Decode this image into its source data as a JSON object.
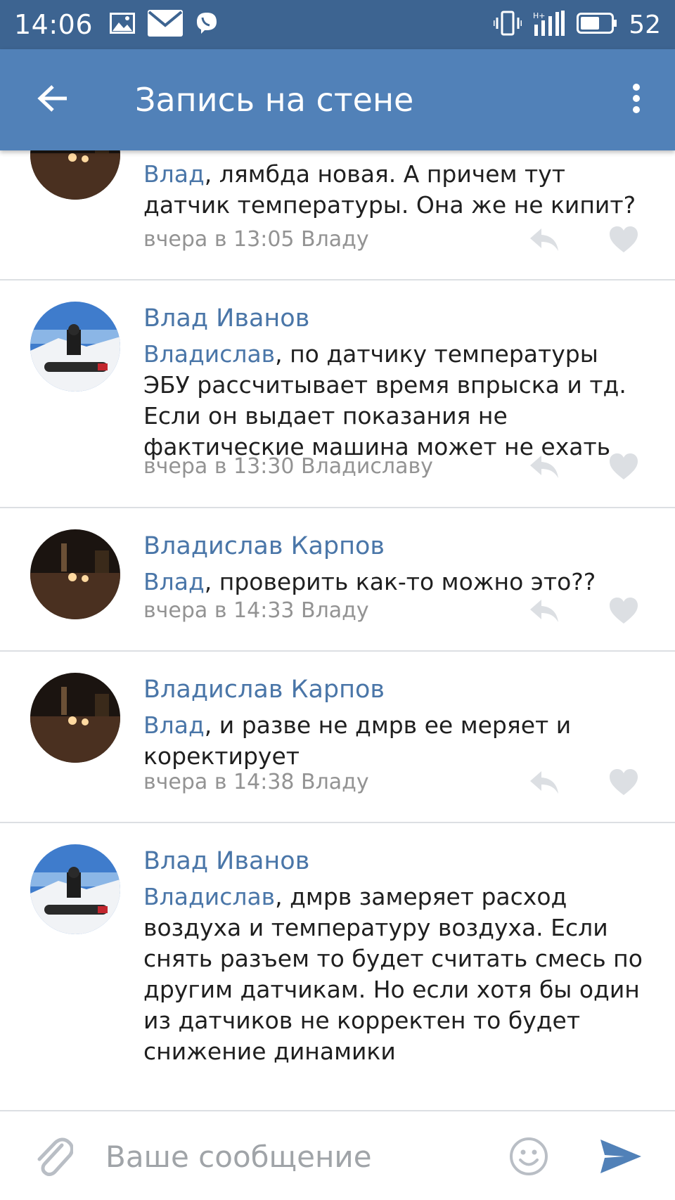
{
  "status_bar": {
    "time": "14:06",
    "battery": "52",
    "icons_left": [
      "gallery-icon",
      "mail-icon",
      "viber-icon"
    ],
    "icons_right": [
      "vibrate-icon",
      "signal-icon",
      "battery-icon"
    ]
  },
  "header": {
    "title": "Запись на стене",
    "back_icon": "arrow-left-icon",
    "menu_icon": "more-vertical-icon",
    "color": "#5181b8"
  },
  "comments": [
    {
      "author": "",
      "mention": "Влад",
      "text": ", лямбда новая.  А причем тут датчик температуры.  Она же не кипит?",
      "lines": [
        "лямбда новая.  А причем тут",
        "датчик температуры.  Она же не кипит?"
      ],
      "meta": "вчера в 13:05 Владу",
      "avatar": "night-road"
    },
    {
      "author": "Влад Иванов",
      "mention": "Владислав",
      "lines": [
        "по датчику температуры",
        "ЭБУ рассчитывает время впрыска и  тд.",
        "Если он выдает показания не",
        "фактические машина может не ехать"
      ],
      "meta": "вчера в 13:30 Владиславу",
      "avatar": "snowboarder"
    },
    {
      "author": "Владислав Карпов",
      "mention": "Влад",
      "lines": [
        "проверить как-то можно это??"
      ],
      "meta": "вчера в 14:33 Владу",
      "avatar": "night-road"
    },
    {
      "author": "Владислав Карпов",
      "mention": "Влад",
      "lines": [
        "и разве не дмрв ее меряет и",
        "коректирует"
      ],
      "meta": "вчера в 14:38 Владу",
      "avatar": "night-road"
    },
    {
      "author": "Влад Иванов",
      "mention": "Владислав",
      "lines": [
        "дмрв замеряет расход",
        "воздуха и температуру воздуха. Если",
        "снять разъем то будет считать смесь по",
        "другим датчикам. Но если хотя бы один",
        "из датчиков не корректен то будет",
        "снижение динамики"
      ],
      "meta": "",
      "avatar": "snowboarder"
    }
  ],
  "composer": {
    "placeholder": "Ваше сообщение",
    "attach_icon": "paperclip-icon",
    "emoji_icon": "smiley-icon",
    "send_icon": "send-icon"
  },
  "colors": {
    "accent": "#5181b8",
    "status_bar": "#3d6491",
    "link": "#4a76a8",
    "meta": "#939393",
    "divider": "#dcdfe3"
  }
}
